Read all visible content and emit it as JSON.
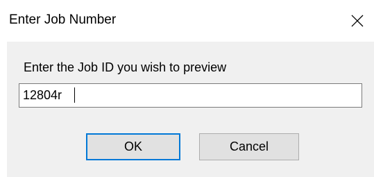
{
  "window": {
    "title": "Enter Job Number",
    "close_icon": "close-icon"
  },
  "form": {
    "prompt": "Enter the Job ID you wish to preview",
    "job_id_value": "12804r"
  },
  "buttons": {
    "ok_label": "OK",
    "cancel_label": "Cancel"
  },
  "colors": {
    "default_button_border": "#0078d7",
    "client_background": "#f0f0f0",
    "button_face": "#e1e1e1"
  }
}
